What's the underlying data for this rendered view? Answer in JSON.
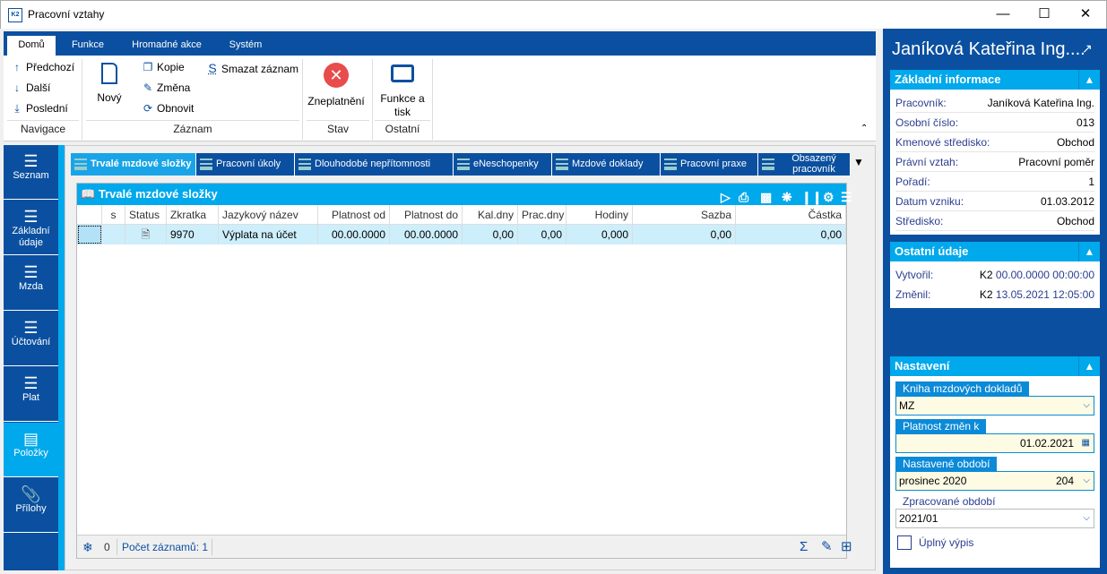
{
  "window": {
    "title": "Pracovní vztahy",
    "logo": "K2",
    "controls": [
      "minimize-icon",
      "maximize-icon",
      "close-icon"
    ]
  },
  "ribbon": {
    "tabs": [
      "Domů",
      "Funkce",
      "Hromadné akce",
      "Systém"
    ],
    "groups": {
      "navigace": {
        "label": "Navigace",
        "items": [
          "Předchozí",
          "Další",
          "Poslední"
        ]
      },
      "zaznam": {
        "label": "Záznam",
        "new": "Nový",
        "items": [
          "Kopie",
          "Změna",
          "Obnovit"
        ],
        "delete": "Smazat záznam"
      },
      "stav": {
        "label": "Stav",
        "item": "Zneplatnění"
      },
      "ostatni": {
        "label": "Ostatní",
        "item1": "Funkce a",
        "item2": "tisk"
      }
    }
  },
  "leftnav": [
    {
      "label": "Seznam",
      "icon": "list-icon"
    },
    {
      "label1": "Základní",
      "label2": "údaje",
      "icon": "list-icon"
    },
    {
      "label": "Mzda",
      "icon": "list-icon"
    },
    {
      "label": "Účtování",
      "icon": "list-icon"
    },
    {
      "label": "Plat",
      "icon": "list-icon"
    },
    {
      "label": "Položky",
      "icon": "box-icon",
      "active": true
    },
    {
      "label": "Přílohy",
      "icon": "paperclip-icon"
    }
  ],
  "tabs": [
    "Trvalé mzdové složky",
    "Pracovní úkoly",
    "Dlouhodobé nepřítomnosti",
    "eNeschopenky",
    "Mzdové doklady",
    "Pracovní praxe",
    "Obsazený",
    "pracovník"
  ],
  "grid": {
    "title": "Trvalé mzdové složky",
    "columns": [
      "s",
      "Status",
      "Zkratka",
      "Jazykový název",
      "Platnost od",
      "Platnost do",
      "Kal.dny",
      "Prac.dny",
      "Hodiny",
      "Sazba",
      "Částka"
    ],
    "rows": [
      [
        "",
        "document-add-icon",
        "9970",
        "Výplata na účet",
        "00.00.0000",
        "00.00.0000",
        "0,00",
        "0,00",
        "0,000",
        "0,00",
        "0,00"
      ]
    ],
    "status": {
      "selected": "0",
      "count": "Počet záznamů: 1"
    }
  },
  "right": {
    "title": "Janíková Kateřina Ing....",
    "basic": {
      "header": "Základní informace",
      "rows": [
        {
          "k": "Pracovník:",
          "v": "Janíková Kateřina Ing."
        },
        {
          "k": "Osobní číslo:",
          "v": "013"
        },
        {
          "k": "Kmenové středisko:",
          "v": "Obchod"
        },
        {
          "k": "Právní vztah:",
          "v": "Pracovní poměr"
        },
        {
          "k": "Pořadí:",
          "v": "1"
        },
        {
          "k": "Datum vzniku:",
          "v": "01.03.2012"
        },
        {
          "k": "Středisko:",
          "v": "Obchod"
        }
      ]
    },
    "other": {
      "header": "Ostatní údaje",
      "rows": [
        {
          "k": "Vytvořil:",
          "u": "K2",
          "v": "00.00.0000 00:00:00"
        },
        {
          "k": "Změnil:",
          "u": "K2",
          "v": "13.05.2021 12:05:00"
        }
      ]
    },
    "settings": {
      "header": "Nastavení",
      "kniha": {
        "label": "Kniha mzdových dokladů",
        "value": "MZ"
      },
      "platnost": {
        "label": "Platnost změn k",
        "value": "01.02.2021"
      },
      "nastavene": {
        "label": "Nastavené období",
        "value": "prosinec 2020",
        "num": "204"
      },
      "zpracovane": {
        "label": "Zpracované období",
        "value": "2021/01"
      },
      "uplny": {
        "label": "Úplný výpis",
        "checked": false
      }
    }
  },
  "colors": {
    "dark_blue": "#0b50a0",
    "light_blue": "#00a8ec",
    "red": "#e84c4c"
  }
}
